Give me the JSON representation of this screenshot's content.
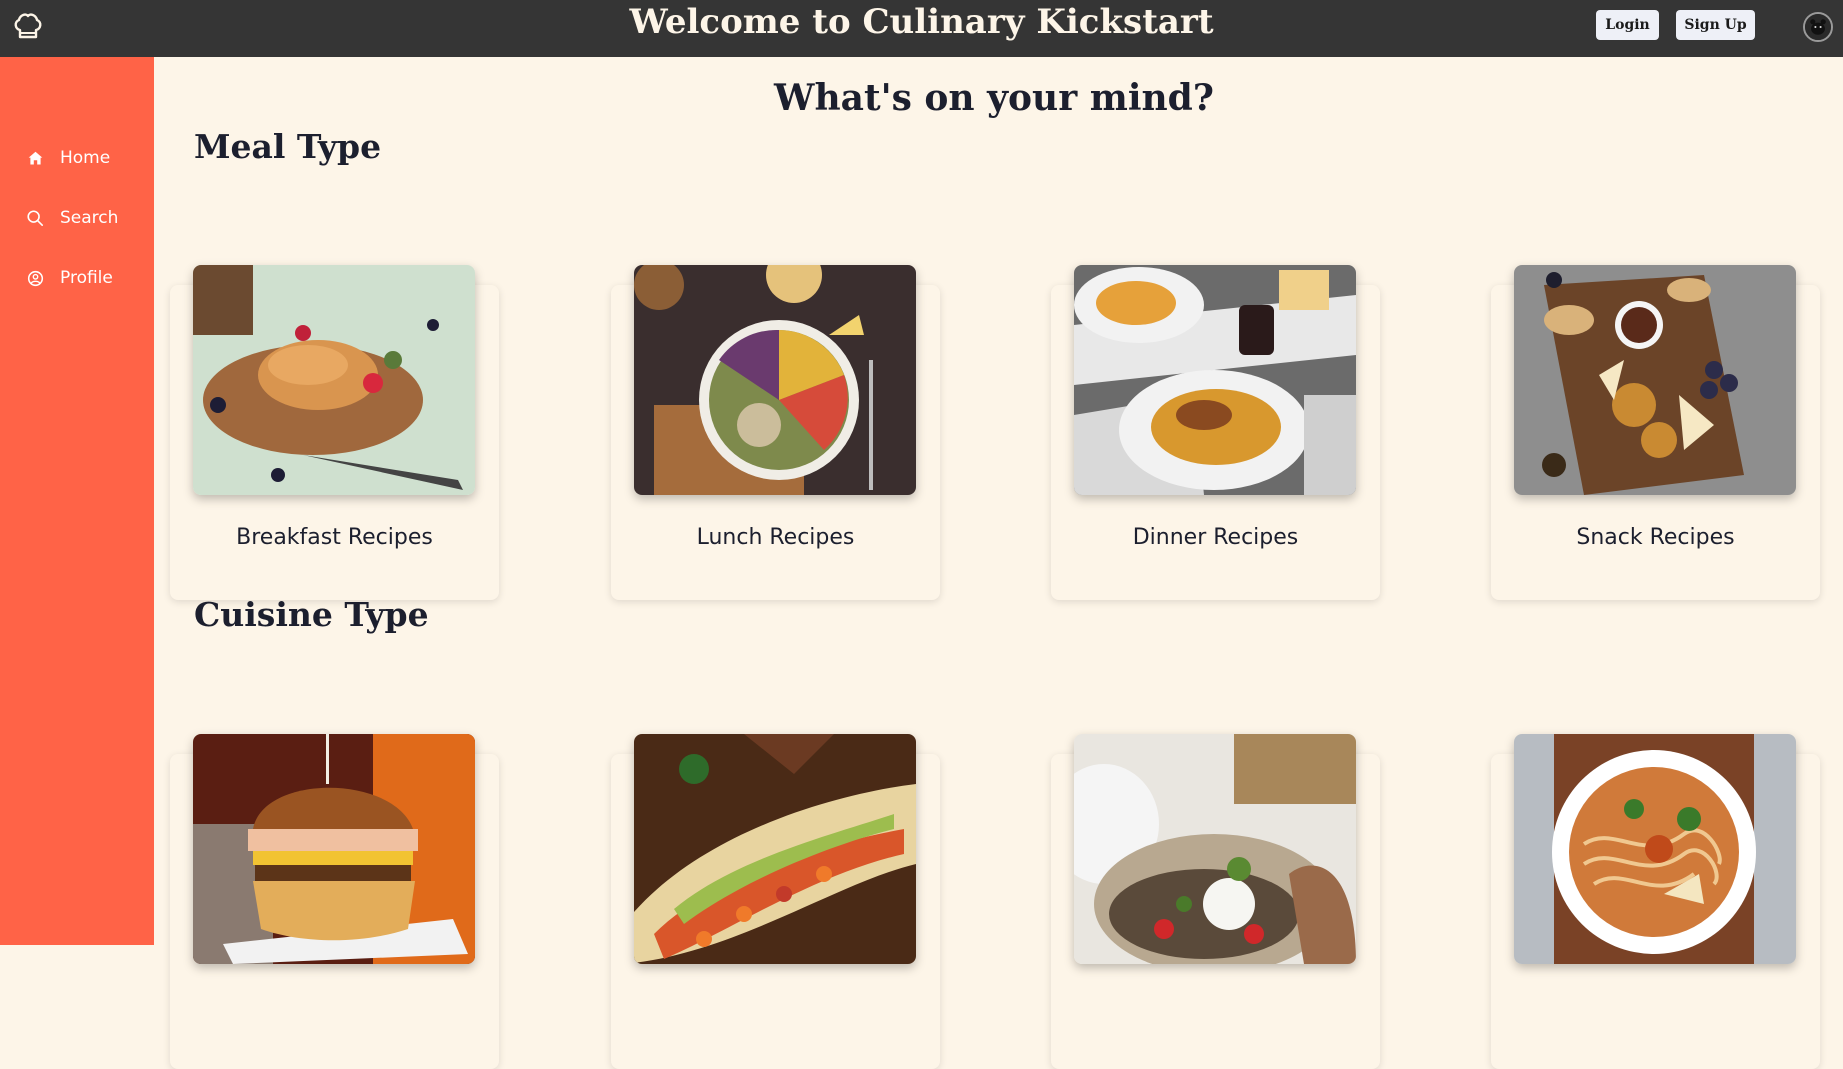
{
  "header": {
    "title": "Welcome to Culinary Kickstart",
    "login_label": "Login",
    "signup_label": "Sign Up",
    "logo_icon": "chef-hat-icon",
    "avatar_icon": "user-avatar"
  },
  "sidebar": {
    "items": [
      {
        "label": "Home",
        "icon": "home-icon"
      },
      {
        "label": "Search",
        "icon": "search-icon"
      },
      {
        "label": "Profile",
        "icon": "profile-icon"
      }
    ]
  },
  "main": {
    "prompt": "What's on your mind?",
    "meal_section": {
      "title": "Meal Type",
      "cards": [
        {
          "label": "Breakfast Recipes"
        },
        {
          "label": "Lunch Recipes"
        },
        {
          "label": "Dinner Recipes"
        },
        {
          "label": "Snack Recipes"
        }
      ]
    },
    "cuisine_section": {
      "title": "Cuisine Type"
    }
  },
  "colors": {
    "topbar": "#353535",
    "sidebar": "#ff6347",
    "background": "#fdf5e8",
    "text": "#1c1f2e"
  }
}
